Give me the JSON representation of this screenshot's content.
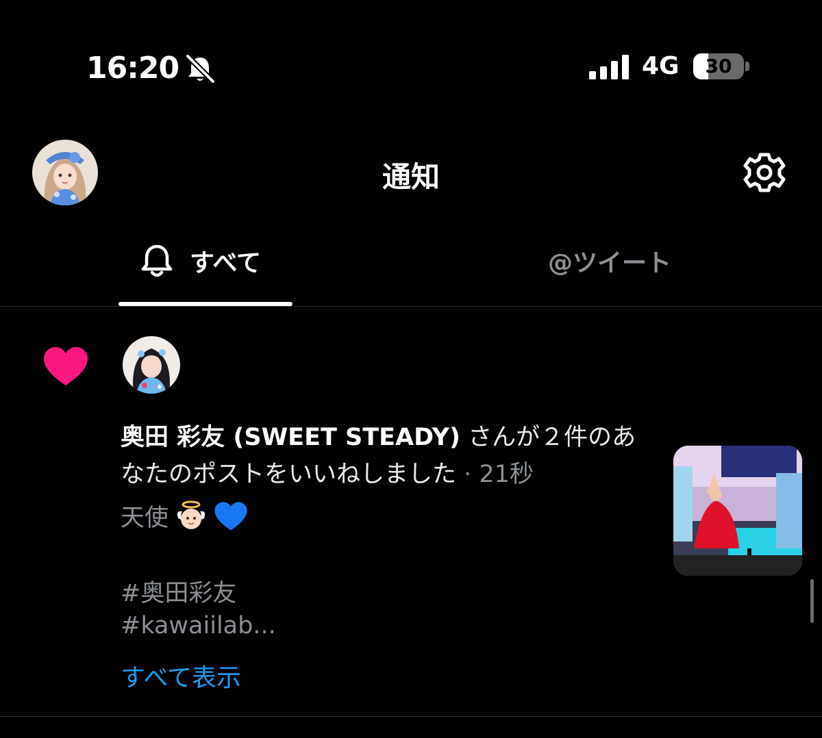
{
  "status_bar": {
    "time": "16:20",
    "network": "4G",
    "battery_percent": "30",
    "battery_level": 0.3,
    "icons": [
      "bell-slash-icon",
      "signal-icon"
    ]
  },
  "header": {
    "title": "通知",
    "avatar": "user-avatar",
    "settings_icon": "gear-icon"
  },
  "tabs": [
    {
      "label": "すべて",
      "icon": "bell-icon",
      "selected": true
    },
    {
      "label": "@ツイート",
      "selected": false
    }
  ],
  "notification": {
    "type_icon": "heart-icon",
    "type_color": "#f91880",
    "actor_name": "奥田 彩友 (SWEET STEADY)",
    "message": " さんが２件のあなたのポストをいいねしました",
    "separator": " · ",
    "timestamp": "21秒",
    "post_text": "天使",
    "post_emojis": [
      "angel-emoji",
      "blue-heart-emoji"
    ],
    "hashtag_1": "#奥田彩友",
    "hashtag_2": "#kawaiilab...",
    "show_all": "すべて表示",
    "link_color": "#1d9bf0"
  }
}
